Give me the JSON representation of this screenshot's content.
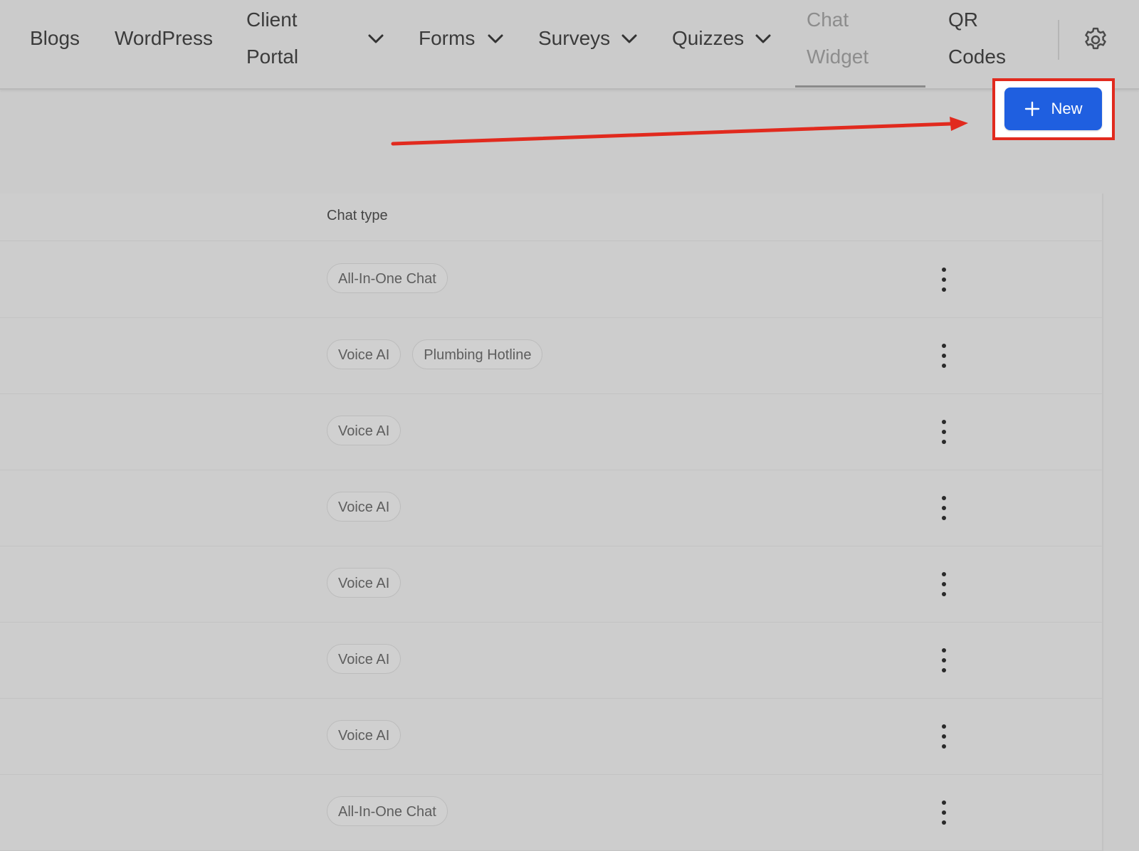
{
  "nav": {
    "blogs": "Blogs",
    "wordpress": "WordPress",
    "client_portal": [
      "Client",
      "Portal"
    ],
    "forms": "Forms",
    "surveys": "Surveys",
    "quizzes": "Quizzes",
    "chat_widget": [
      "Chat",
      "Widget"
    ],
    "qr_codes": [
      "QR",
      "Codes"
    ],
    "settings_icon": "gear-icon",
    "chevron_icon": "chevron-down-icon"
  },
  "toolbar": {
    "new_label": "New",
    "new_icon": "plus-icon",
    "accent_color": "#1f5fe0",
    "highlight_color": "#e12a1e"
  },
  "table": {
    "column_header": "Chat type",
    "rows": [
      {
        "tags": [
          "All-In-One Chat"
        ]
      },
      {
        "tags": [
          "Voice AI",
          "Plumbing Hotline"
        ]
      },
      {
        "tags": [
          "Voice AI"
        ]
      },
      {
        "tags": [
          "Voice AI"
        ]
      },
      {
        "tags": [
          "Voice AI"
        ]
      },
      {
        "tags": [
          "Voice AI"
        ]
      },
      {
        "tags": [
          "Voice AI"
        ]
      },
      {
        "tags": [
          "All-In-One Chat"
        ]
      }
    ],
    "row_action_icon": "more-vertical-icon"
  }
}
